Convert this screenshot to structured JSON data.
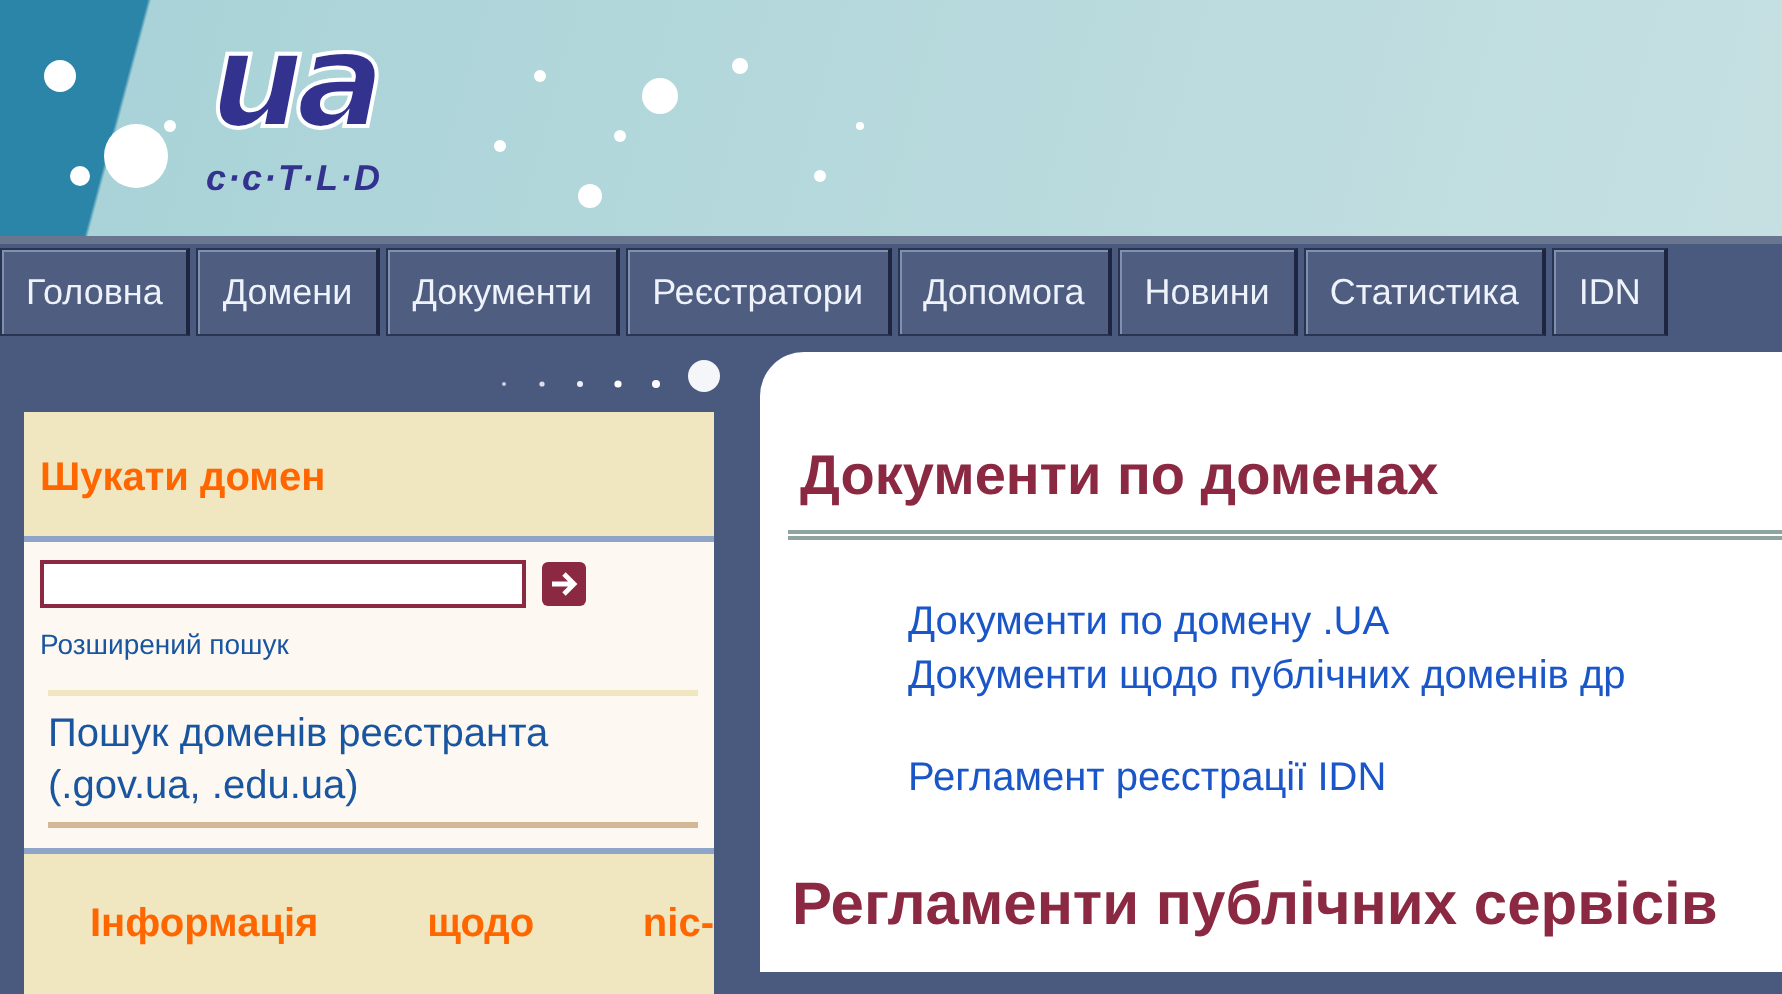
{
  "logo": {
    "text": "ua",
    "subtitle": "c·c·T·L·D"
  },
  "menu": [
    {
      "label": "Головна"
    },
    {
      "label": "Домени"
    },
    {
      "label": "Документи"
    },
    {
      "label": "Реєстратори"
    },
    {
      "label": "Допомога"
    },
    {
      "label": "Новини"
    },
    {
      "label": "Статистика"
    },
    {
      "label": "IDN"
    }
  ],
  "sidebar": {
    "search_title": "Шукати домен",
    "advanced_link": "Розширений пошук",
    "registrant_link": "Пошук доменів реєстранта (.gov.ua, .edu.ua)",
    "info_title": "Інформація щодо nic-"
  },
  "content": {
    "heading": "Документи по доменах",
    "link_groups": [
      [
        "Документи по домену .UA",
        "Документи щодо публічних доменів др"
      ],
      [
        "Регламент реєстрації IDN"
      ]
    ],
    "heading_2": "Регламенти публічних сервісів"
  }
}
